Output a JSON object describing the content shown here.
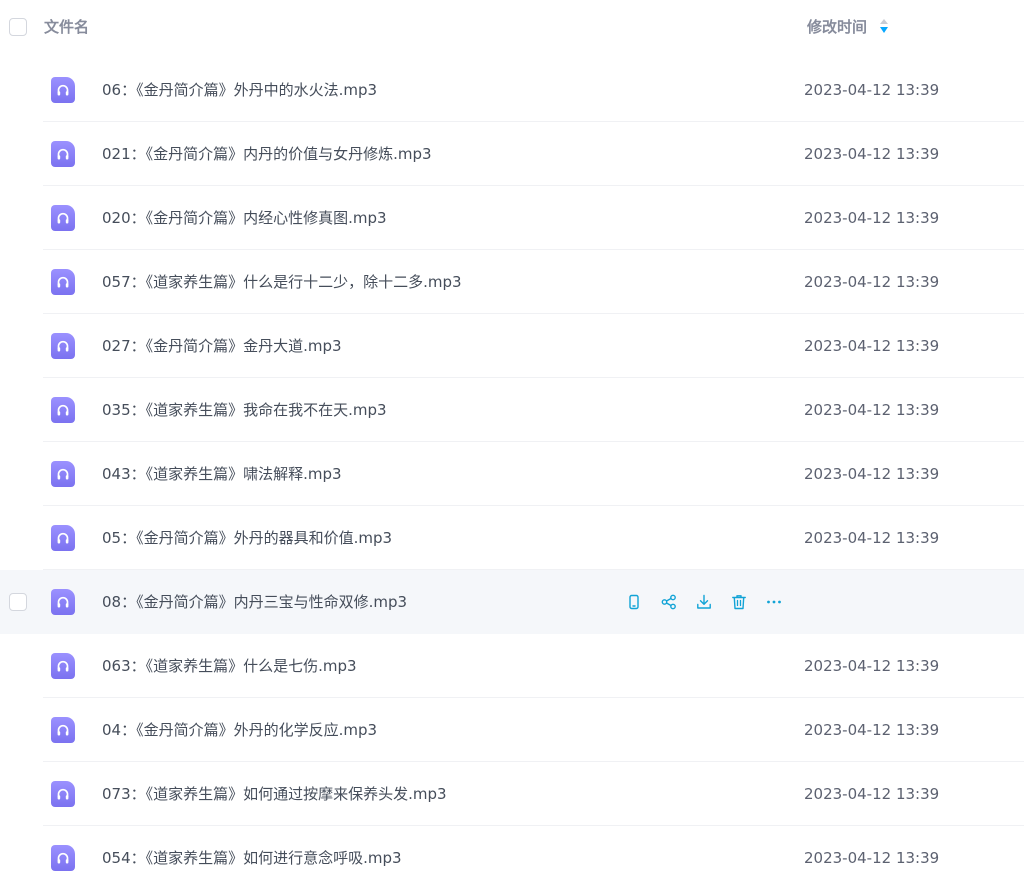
{
  "header": {
    "name_label": "文件名",
    "time_label": "修改时间"
  },
  "colors": {
    "accent": "#06a7ff",
    "action_icon": "#11a3d6",
    "file_icon": "#8b82f8",
    "hover_row": "#f5f7fa"
  },
  "file_icon_name": "headphones-icon",
  "row_actions": [
    {
      "name": "phone-icon"
    },
    {
      "name": "share-icon"
    },
    {
      "name": "download-icon"
    },
    {
      "name": "delete-icon"
    },
    {
      "name": "more-icon"
    }
  ],
  "files": [
    {
      "name": "06：《金丹简介篇》外丹中的水火法.mp3",
      "time": "2023-04-12 13:39",
      "hovered": false
    },
    {
      "name": "021：《金丹简介篇》内丹的价值与女丹修炼.mp3",
      "time": "2023-04-12 13:39",
      "hovered": false
    },
    {
      "name": "020：《金丹简介篇》内经心性修真图.mp3",
      "time": "2023-04-12 13:39",
      "hovered": false
    },
    {
      "name": "057：《道家养生篇》什么是行十二少，除十二多.mp3",
      "time": "2023-04-12 13:39",
      "hovered": false
    },
    {
      "name": "027：《金丹简介篇》金丹大道.mp3",
      "time": "2023-04-12 13:39",
      "hovered": false
    },
    {
      "name": "035：《道家养生篇》我命在我不在天.mp3",
      "time": "2023-04-12 13:39",
      "hovered": false
    },
    {
      "name": "043：《道家养生篇》啸法解释.mp3",
      "time": "2023-04-12 13:39",
      "hovered": false
    },
    {
      "name": "05：《金丹简介篇》外丹的器具和价值.mp3",
      "time": "2023-04-12 13:39",
      "hovered": false
    },
    {
      "name": "08：《金丹简介篇》内丹三宝与性命双修.mp3",
      "time": "",
      "hovered": true
    },
    {
      "name": "063：《道家养生篇》什么是七伤.mp3",
      "time": "2023-04-12 13:39",
      "hovered": false
    },
    {
      "name": "04：《金丹简介篇》外丹的化学反应.mp3",
      "time": "2023-04-12 13:39",
      "hovered": false
    },
    {
      "name": "073：《道家养生篇》如何通过按摩来保养头发.mp3",
      "time": "2023-04-12 13:39",
      "hovered": false
    },
    {
      "name": "054：《道家养生篇》如何进行意念呼吸.mp3",
      "time": "2023-04-12 13:39",
      "hovered": false
    }
  ]
}
